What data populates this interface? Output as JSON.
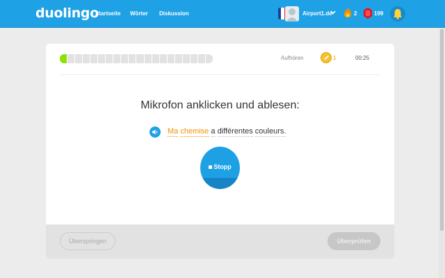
{
  "header": {
    "logo": "duolingo",
    "nav": [
      "Startseite",
      "Wörter",
      "Diskussion"
    ],
    "username": "Airport1.de",
    "streak": "2",
    "gems": "199",
    "brand_color": "#1fa1e6"
  },
  "lesson": {
    "progress_segments_total": 20,
    "progress_segments_done": 1,
    "quit_label": "Aufhören",
    "coins": "1",
    "timer": "00:25",
    "prompt": "Mikrofon anklicken und ablesen:",
    "sentence": {
      "highlighted": [
        "Ma",
        "chemise"
      ],
      "plain": [
        "a",
        "différentes",
        "couleurs."
      ]
    },
    "stop_label": "Stopp",
    "skip_label": "Überspringen",
    "check_label": "Überprüfen"
  },
  "icons": {
    "flag": "french-flag-icon",
    "avatar": "user-avatar-icon",
    "streak": "flame-icon",
    "gems": "ruby-gem-icon",
    "bell": "bell-icon",
    "speaker": "speaker-icon",
    "coin": "lingot-coin-icon",
    "stop": "stop-square-icon"
  }
}
